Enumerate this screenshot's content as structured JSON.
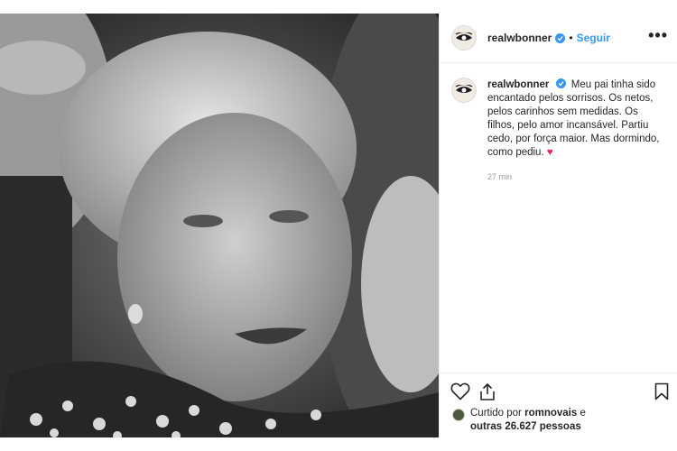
{
  "post": {
    "username": "realwbonner",
    "follow_label": "Seguir",
    "separator": "•",
    "more_label": "•••",
    "caption_username": "realwbonner",
    "caption": "Meu pai tinha sido encantado pelos sorrisos. Os netos, pelos carinhos sem medidas. Os filhos, pelo amor incansável. Partiu cedo, por força maior. Mas dormindo, como pediu.",
    "caption_emoji": "♥",
    "timestamp": "27 min",
    "likes_prefix": "Curtido por",
    "likes_user": "romnovais",
    "likes_conj": "e",
    "likes_others": "outras 26.627 pessoas"
  },
  "icons": {
    "like": "heart-outline-icon",
    "share": "share-icon",
    "save": "bookmark-icon",
    "verified": "verified-badge-icon",
    "more": "more-options-icon"
  },
  "colors": {
    "accent": "#3897f0",
    "heart": "#e0245e",
    "text": "#262626",
    "muted": "#999999"
  }
}
